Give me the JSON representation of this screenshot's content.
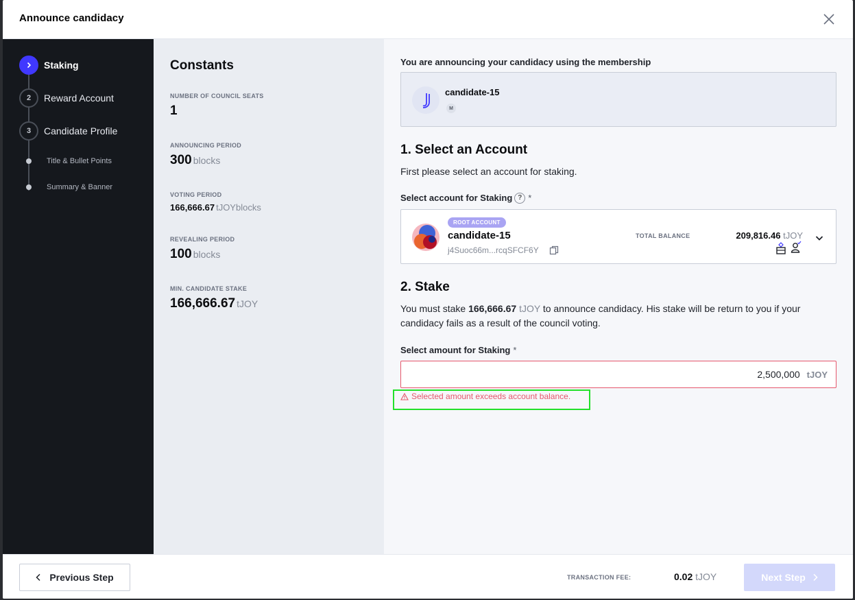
{
  "modal": {
    "title": "Announce candidacy"
  },
  "steps": [
    {
      "number": "",
      "label": "Staking",
      "active": true
    },
    {
      "number": "2",
      "label": "Reward Account",
      "active": false
    },
    {
      "number": "3",
      "label": "Candidate Profile",
      "active": false
    }
  ],
  "substeps": [
    {
      "label": "Title & Bullet Points"
    },
    {
      "label": "Summary & Banner"
    }
  ],
  "constants": {
    "title": "Constants",
    "items": [
      {
        "label": "NUMBER OF COUNCIL SEATS",
        "value": "1",
        "unit": ""
      },
      {
        "label": "ANNOUNCING PERIOD",
        "value": "300",
        "unit": "blocks"
      },
      {
        "label": "VOTING PERIOD",
        "value": "166,666.67",
        "unit": "tJOYblocks"
      },
      {
        "label": "REVEALING PERIOD",
        "value": "100",
        "unit": "blocks"
      },
      {
        "label": "MIN. CANDIDATE STAKE",
        "value": "166,666.67",
        "unit": "tJOY"
      }
    ]
  },
  "main": {
    "membership_label": "You are announcing your candidacy using the membership",
    "member": {
      "name": "candidate-15",
      "badge": "M"
    },
    "section1": {
      "title": "1. Select an Account",
      "text": "First please select an account for staking.",
      "field_label": "Select account for Staking",
      "required_mark": "*",
      "help": "?"
    },
    "account": {
      "tag": "ROOT ACCOUNT",
      "name": "candidate-15",
      "address": "j4Suoc66m...rcqSFCF6Y",
      "balance_label": "TOTAL BALANCE",
      "balance_value": "209,816.46",
      "balance_unit": "tJOY"
    },
    "section2": {
      "title": "2. Stake",
      "text_before": "You must stake ",
      "stake_value": "166,666.67",
      "stake_unit": "tJOY",
      "text_after": " to announce candidacy. His stake will be return to you if your candidacy fails as a result of the council voting.",
      "field_label": "Select amount for Staking",
      "required_mark": "*"
    },
    "amount": {
      "value": "2,500,000",
      "unit": "tJOY"
    },
    "error": "Selected amount exceeds account balance."
  },
  "footer": {
    "prev_label": "Previous Step",
    "fee_label": "TRANSACTION FEE:",
    "fee_value": "0.02",
    "fee_unit": "tJOY",
    "next_label": "Next Step"
  },
  "colors": {
    "accent": "#4038ff",
    "error": "#e5566b",
    "highlight": "#22e02a",
    "next_disabled": "#d3d8fb"
  }
}
